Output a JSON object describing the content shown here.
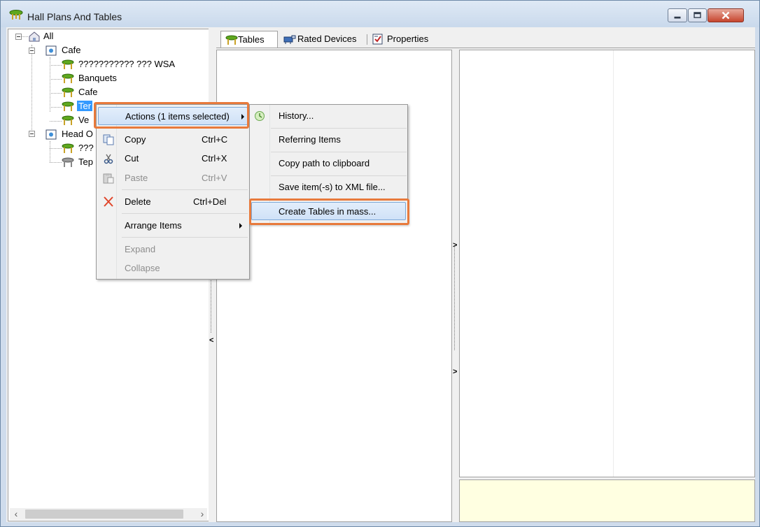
{
  "window": {
    "title": "Hall Plans And Tables"
  },
  "tree": {
    "items": [
      {
        "label": "All"
      },
      {
        "label": "Cafe"
      },
      {
        "label": "??????????? ??? WSA"
      },
      {
        "label": "Banquets"
      },
      {
        "label": "Cafe"
      },
      {
        "label": "Ter"
      },
      {
        "label": "Ve"
      },
      {
        "label": "Head O"
      },
      {
        "label": "???"
      },
      {
        "label": "Tep"
      }
    ]
  },
  "tabs": [
    {
      "label": "Tables"
    },
    {
      "label": "Rated Devices"
    },
    {
      "label": "Properties"
    }
  ],
  "context_menu": {
    "items": [
      {
        "label": "Actions (1 items selected)"
      },
      {
        "label": "Copy",
        "shortcut": "Ctrl+C"
      },
      {
        "label": "Cut",
        "shortcut": "Ctrl+X"
      },
      {
        "label": "Paste",
        "shortcut": "Ctrl+V"
      },
      {
        "label": "Delete",
        "shortcut": "Ctrl+Del"
      },
      {
        "label": "Arrange Items"
      },
      {
        "label": "Expand"
      },
      {
        "label": "Collapse"
      }
    ]
  },
  "submenu": {
    "items": [
      {
        "label": "History..."
      },
      {
        "label": "Referring Items"
      },
      {
        "label": "Copy path to clipboard"
      },
      {
        "label": "Save item(-s) to XML file..."
      },
      {
        "label": "Create Tables in mass..."
      }
    ]
  },
  "colors": {
    "highlight": "#e87a3c",
    "selection": "#3399ff",
    "info_panel": "#ffffe1"
  },
  "icons": {
    "title": "table-icon",
    "tree_root": "house-icon",
    "tree_section": "plan-icon",
    "tree_table": "table-icon",
    "tab_tables": "table-icon",
    "tab_rated_devices": "device-icon",
    "tab_properties": "properties-icon",
    "menu_copy": "copy-icon",
    "menu_cut": "scissors-icon",
    "menu_paste": "paste-icon",
    "menu_delete": "delete-icon",
    "submenu_history": "history-icon"
  }
}
